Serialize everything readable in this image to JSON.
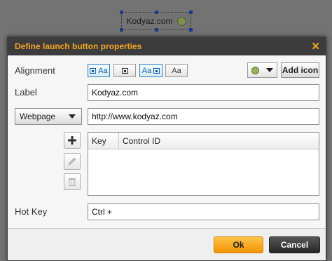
{
  "preview": {
    "text": "Kodyaz.com",
    "icon": "lightbulb-icon"
  },
  "dialog": {
    "title": "Define launch button properties",
    "close_icon": "close-icon"
  },
  "alignment": {
    "label": "Alignment",
    "options": [
      {
        "text": "Aa",
        "icon": "image-left-icon",
        "selected": true
      },
      {
        "text": "",
        "icon": "image-only-icon",
        "selected": false
      },
      {
        "text": "Aa",
        "icon": "image-right-icon",
        "selected": true
      },
      {
        "text": "Aa",
        "icon": "text-only-icon",
        "selected": false
      }
    ],
    "icon_select": {
      "icon": "lightbulb-icon"
    },
    "add_icon_label": "Add icon"
  },
  "label_field": {
    "label": "Label",
    "value": "Kodyaz.com"
  },
  "type_select": {
    "value": "Webpage"
  },
  "url_field": {
    "value": "http://www.kodyaz.com"
  },
  "grid": {
    "columns": [
      "Key",
      "Control ID"
    ],
    "rows": []
  },
  "side_buttons": [
    {
      "icon": "plus-icon"
    },
    {
      "icon": "pencil-icon"
    },
    {
      "icon": "trash-icon"
    }
  ],
  "hotkey": {
    "label": "Hot Key",
    "value": "Ctrl +"
  },
  "footer": {
    "ok_label": "Ok",
    "cancel_label": "Cancel"
  },
  "colors": {
    "accent": "#f5a623",
    "ok": "#f39200",
    "titlebar": "#3c3c3c",
    "selected": "#2c7fc4"
  }
}
